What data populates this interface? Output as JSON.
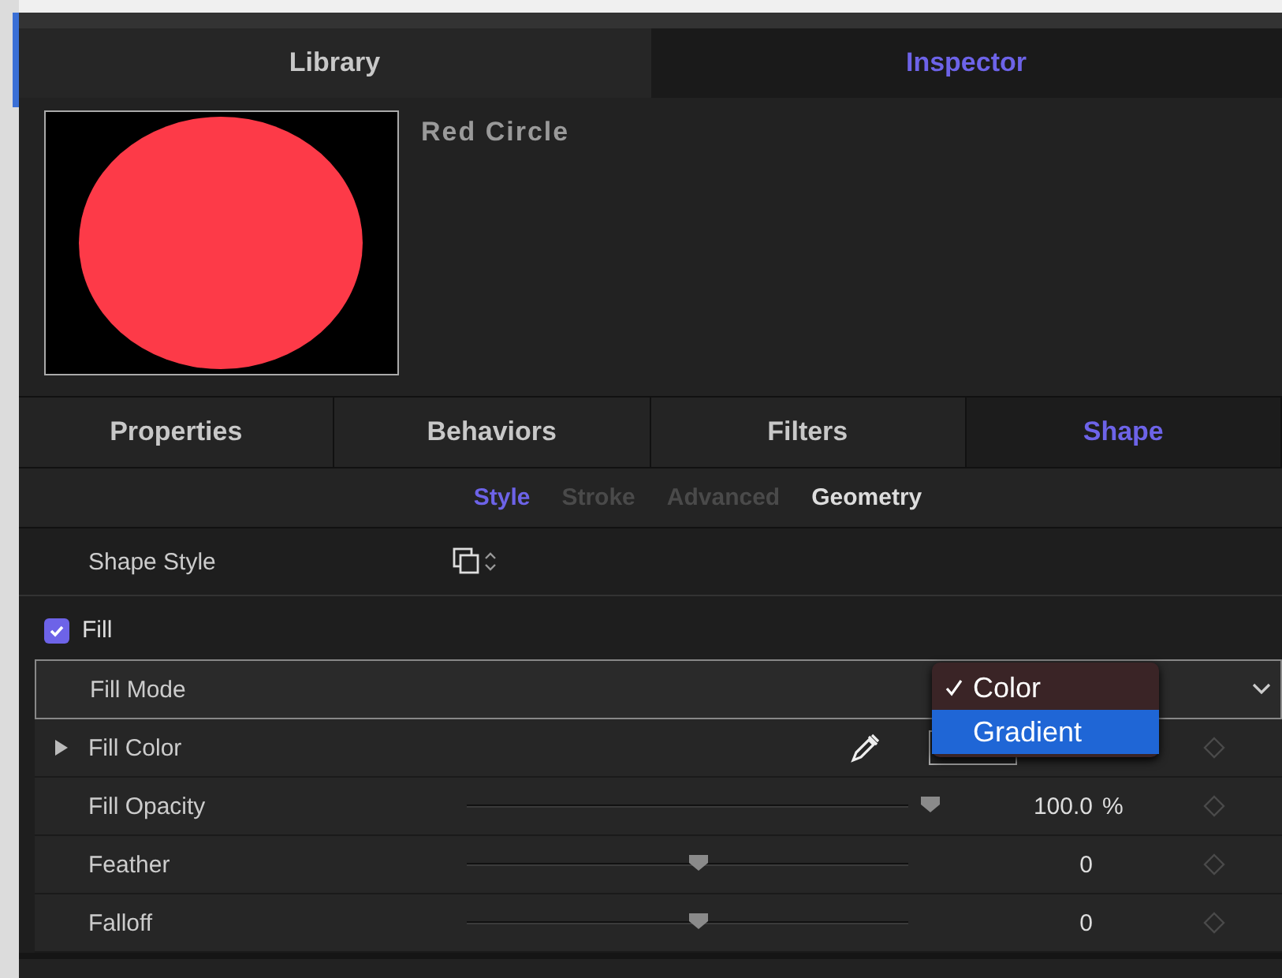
{
  "top_tabs": [
    {
      "label": "Library",
      "selected": false
    },
    {
      "label": "Inspector",
      "selected": true
    }
  ],
  "object": {
    "name": "Red Circle"
  },
  "inspector_tabs": [
    {
      "label": "Properties",
      "selected": false
    },
    {
      "label": "Behaviors",
      "selected": false
    },
    {
      "label": "Filters",
      "selected": false
    },
    {
      "label": "Shape",
      "selected": true
    }
  ],
  "sub_tabs": [
    {
      "label": "Style",
      "selected": true,
      "disabled": false
    },
    {
      "label": "Stroke",
      "selected": false,
      "disabled": true
    },
    {
      "label": "Advanced",
      "selected": false,
      "disabled": true
    },
    {
      "label": "Geometry",
      "selected": false,
      "disabled": false
    }
  ],
  "shape_style": {
    "label": "Shape Style"
  },
  "fill": {
    "label": "Fill",
    "checked": true,
    "rows": [
      {
        "kind": "dropdown",
        "label": "Fill Mode",
        "menu": [
          {
            "label": "Color",
            "checked": true,
            "highlighted": false
          },
          {
            "label": "Gradient",
            "checked": false,
            "highlighted": true
          }
        ]
      },
      {
        "kind": "color",
        "label": "Fill Color",
        "expanded": false
      },
      {
        "kind": "slider",
        "label": "Fill Opacity",
        "level": 1.0,
        "value": "100.0",
        "unit": "%"
      },
      {
        "kind": "slider",
        "label": "Feather",
        "level": 0.5,
        "value": "0"
      },
      {
        "kind": "slider",
        "label": "Falloff",
        "level": 0.5,
        "value": "0"
      }
    ]
  }
}
